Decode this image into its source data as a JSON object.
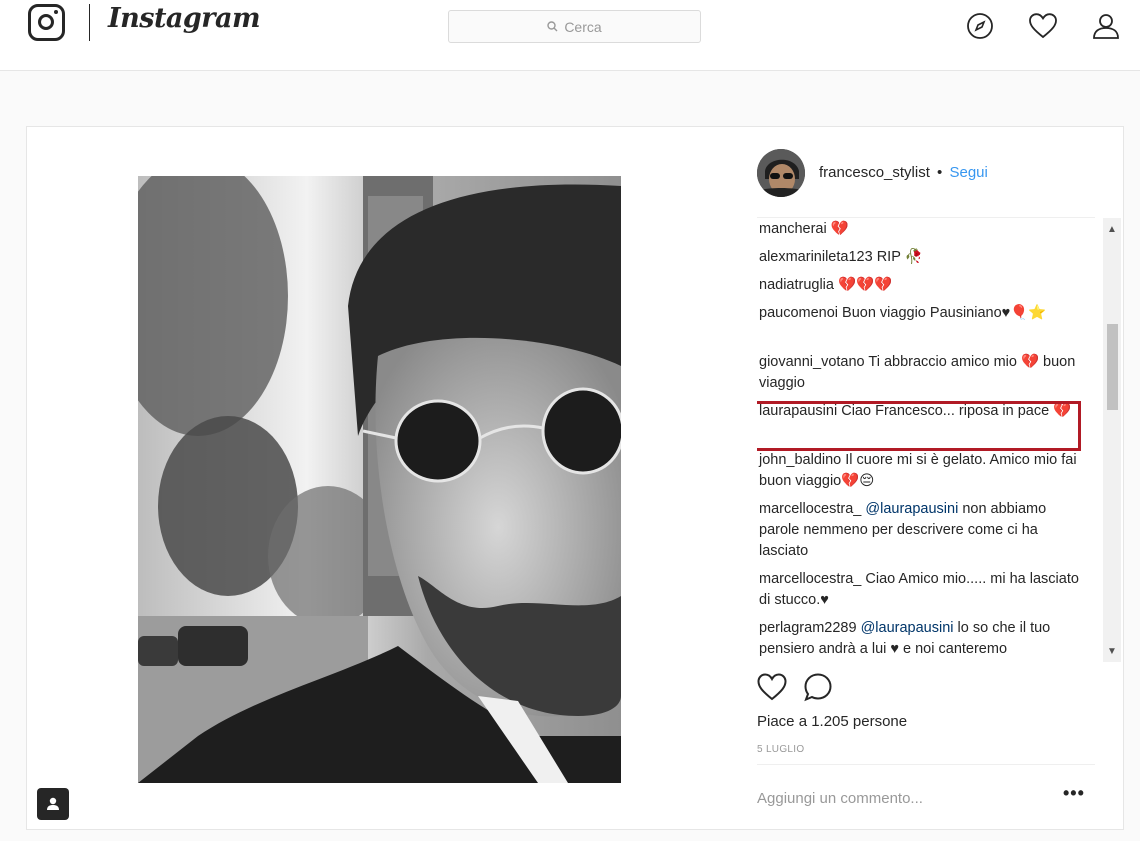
{
  "header": {
    "wordmark": "Instagram",
    "search_placeholder": "Cerca",
    "icons": [
      "instagram-logo-icon",
      "search-icon",
      "compass-icon",
      "heart-icon",
      "profile-icon"
    ]
  },
  "post": {
    "author": "francesco_stylist",
    "separator": "•",
    "follow_label": "Segui",
    "likes_text": "Piace a 1.205 persone",
    "date": "5 LUGLIO",
    "add_comment_placeholder": "Aggiungi un commento...",
    "more_label": "•••"
  },
  "comments": [
    {
      "user": "",
      "text": "mancherai 💔"
    },
    {
      "user": "alexmarinileta123",
      "text": "RIP 🥀"
    },
    {
      "user": "nadiatruglia",
      "text": "💔💔💔"
    },
    {
      "user": "paucomenoi",
      "text": "Buon viaggio Pausiniano♥🎈⭐"
    },
    {
      "user": "giovanni_votano",
      "text": "Ti abbraccio amico mio 💔 buon viaggio"
    },
    {
      "user": "laurapausini",
      "text": "Ciao Francesco... riposa in pace 💔"
    },
    {
      "user": "john_baldino",
      "text": "Il cuore mi si è gelato. Amico mio fai buon viaggio💔😔"
    },
    {
      "user": "marcellocestra_",
      "mention": "@laurapausini",
      "text": "non abbiamo parole nemmeno per descrivere come ci ha lasciato"
    },
    {
      "user": "marcellocestra_",
      "text": "Ciao Amico mio..... mi ha lasciato di stucco.♥"
    },
    {
      "user": "perlagram2289",
      "mention": "@laurapausini",
      "text": "lo so che il tuo pensiero andrà a lui ♥ e noi canteremo"
    }
  ],
  "colors": {
    "follow": "#3897f0",
    "highlight": "#b11a25",
    "text": "#262626"
  }
}
